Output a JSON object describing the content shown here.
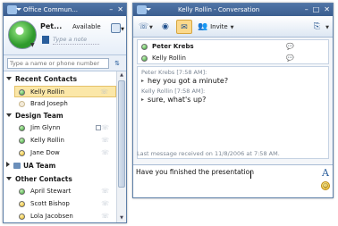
{
  "communicator": {
    "title": "Office Commun...",
    "user": {
      "name": "Pet...",
      "status": "Available",
      "note_placeholder": "Type a note"
    },
    "search": {
      "placeholder": "Type a name or phone number"
    },
    "groups": [
      {
        "name": "Recent Contacts",
        "contacts": [
          {
            "name": "Kelly Rollin",
            "presence": "available",
            "selected": true
          },
          {
            "name": "Brad Joseph",
            "presence": "offline",
            "selected": false
          }
        ]
      },
      {
        "name": "Design Team",
        "contacts": [
          {
            "name": "Jim Glynn",
            "presence": "available",
            "selected": false
          },
          {
            "name": "Kelly Rollin",
            "presence": "available",
            "selected": false
          },
          {
            "name": "Jane Dow",
            "presence": "away",
            "selected": false
          }
        ]
      },
      {
        "name": "UA Team",
        "collapsed": true,
        "contacts": []
      },
      {
        "name": "Other Contacts",
        "contacts": [
          {
            "name": "April Stewart",
            "presence": "available",
            "selected": false
          },
          {
            "name": "Scott Bishop",
            "presence": "away",
            "selected": false
          },
          {
            "name": "Lola Jacobsen",
            "presence": "away",
            "selected": false
          }
        ]
      }
    ]
  },
  "conversation": {
    "title": "Kelly Rollin - Conversation",
    "toolbar": {
      "invite_label": "Invite"
    },
    "participants": [
      {
        "name": "Peter Krebs",
        "presence": "available",
        "bold": true
      },
      {
        "name": "Kelly Rollin",
        "presence": "available",
        "bold": false
      }
    ],
    "messages": [
      {
        "header": "Peter Krebs [7:58 AM]:",
        "text": "hey you got a minute?"
      },
      {
        "header": "Kelly Rollin [7:58 AM]:",
        "text": "sure, what's up?"
      }
    ],
    "last_message": "Last message received on 11/8/2006 at 7:58 AM.",
    "compose_text": "Have you finished the presentation"
  },
  "colors": {
    "titlebar": "#3b5e8f",
    "available": "#34a132",
    "away": "#e7b51f",
    "selected": "#fbe7a8"
  }
}
